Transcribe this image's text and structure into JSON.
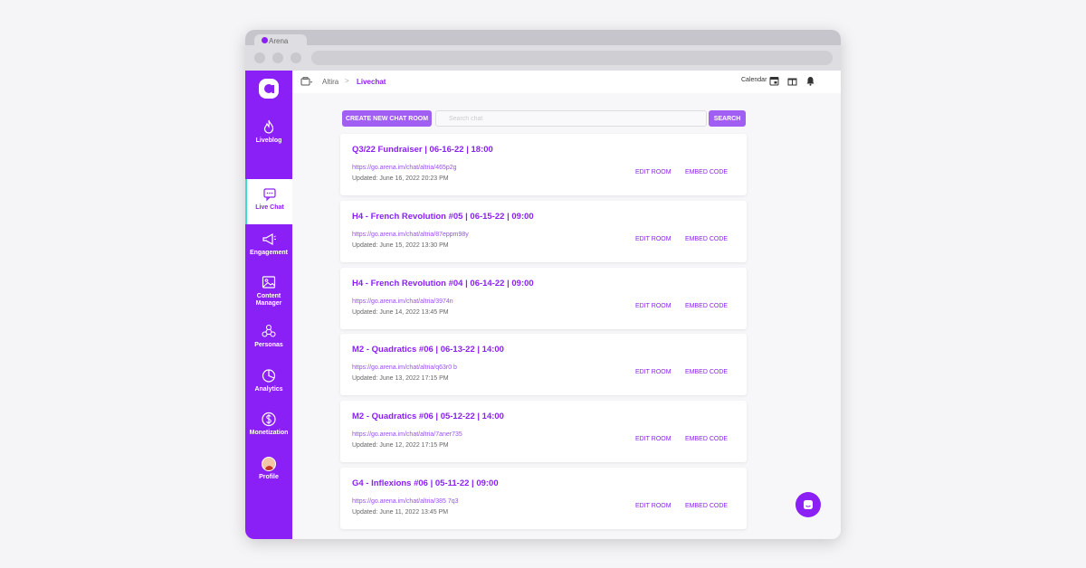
{
  "browser": {
    "tab_title": "Arena"
  },
  "sidebar": {
    "items": [
      {
        "label": "Liveblog",
        "icon": "flame-icon"
      },
      {
        "label": "Live Chat",
        "icon": "chat-icon",
        "active": true
      },
      {
        "label": "Engagement",
        "icon": "megaphone-icon"
      },
      {
        "label": "Content Manager",
        "icon": "image-icon"
      },
      {
        "label": "Personas",
        "icon": "personas-icon"
      },
      {
        "label": "Analytics",
        "icon": "pie-chart-icon"
      },
      {
        "label": "Monetization",
        "icon": "dollar-icon"
      },
      {
        "label": "Profile",
        "icon": "avatar"
      }
    ]
  },
  "topbar": {
    "breadcrumb": [
      "Altira",
      "Livechat"
    ],
    "calendar_label": "Calendar"
  },
  "actions": {
    "create_label": "CREATE NEW CHAT ROOM",
    "search_placeholder": "Search chat",
    "search_label": "SEARCH"
  },
  "rooms": [
    {
      "title": "Q3/22 Fundraiser | 06-16-22 | 18:00",
      "link": "https://go.arena.im/chat/altria/465p2g",
      "updated": "Updated: June 16, 2022 20:23 PM",
      "edit_label": "EDIT ROOM",
      "embed_label": "EMBED CODE"
    },
    {
      "title": "H4 - French Revolution #05 | 06-15-22 | 09:00",
      "link": "https://go.arena.im/chat/altria/87eppm98y",
      "updated": "Updated: June 15, 2022 13:30 PM",
      "edit_label": "EDIT ROOM",
      "embed_label": "EMBED CODE"
    },
    {
      "title": "H4 - French Revolution #04 | 06-14-22 | 09:00",
      "link": "https://go.arena.im/chat/altria/3974n",
      "updated": "Updated: June 14, 2022 13:45 PM",
      "edit_label": "EDIT ROOM",
      "embed_label": "EMBED CODE"
    },
    {
      "title": "M2 - Quadratics #06 | 06-13-22 | 14:00",
      "link": "https://go.arena.im/chat/altria/q63r0 b",
      "updated": "Updated: June 13, 2022 17:15 PM",
      "edit_label": "EDIT ROOM",
      "embed_label": "EMBED CODE"
    },
    {
      "title": "M2 - Quadratics #06 | 05-12-22 | 14:00",
      "link": "https://go.arena.im/chat/altria/7aner735",
      "updated": "Updated: June 12, 2022 17:15 PM",
      "edit_label": "EDIT ROOM",
      "embed_label": "EMBED CODE"
    },
    {
      "title": "G4 - Inflexions #06 | 05-11-22 | 09:00",
      "link": "https://go.arena.im/chat/altria/385 7q3",
      "updated": "Updated: June 11, 2022 13:45 PM",
      "edit_label": "EDIT ROOM",
      "embed_label": "EMBED CODE"
    }
  ],
  "colors": {
    "brand": "#8b20f6",
    "button": "#a15ef2",
    "active_indicator": "#3ddbd0"
  }
}
